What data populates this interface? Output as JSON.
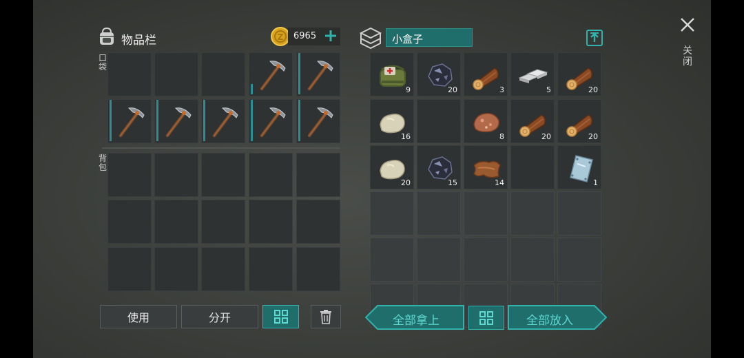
{
  "inventory": {
    "title": "物品栏",
    "currency": "6965",
    "pocket_label": "口袋",
    "backpack_label": "背包",
    "pocket_slots": [
      {
        "item": "",
        "durability": 0
      },
      {
        "item": "",
        "durability": 0
      },
      {
        "item": "",
        "durability": 0
      },
      {
        "item": "pickaxe",
        "durability": 0.25
      },
      {
        "item": "pickaxe",
        "durability": 1.0
      },
      {
        "item": "pickaxe",
        "durability": 1.0
      },
      {
        "item": "pickaxe",
        "durability": 1.0
      },
      {
        "item": "pickaxe",
        "durability": 1.0
      },
      {
        "item": "pickaxe",
        "durability": 1.0
      },
      {
        "item": "pickaxe",
        "durability": 1.0
      }
    ]
  },
  "container": {
    "name": "小盒子",
    "slots": [
      {
        "item": "first-aid-bag",
        "qty": "9"
      },
      {
        "item": "coal-ore",
        "qty": "20"
      },
      {
        "item": "wood-log",
        "qty": "3"
      },
      {
        "item": "iron-ingots",
        "qty": "5"
      },
      {
        "item": "wood-log",
        "qty": "20"
      },
      {
        "item": "stone",
        "qty": "16"
      },
      {
        "item": "",
        "qty": ""
      },
      {
        "item": "copper-ore",
        "qty": "8"
      },
      {
        "item": "wood-log",
        "qty": "20"
      },
      {
        "item": "wood-log",
        "qty": "20"
      },
      {
        "item": "stone",
        "qty": "20"
      },
      {
        "item": "coal-ore",
        "qty": "15"
      },
      {
        "item": "leather",
        "qty": "14"
      },
      {
        "item": "",
        "qty": ""
      },
      {
        "item": "metal-plate",
        "qty": "1"
      }
    ]
  },
  "buttons": {
    "use": "使用",
    "split": "分开",
    "take_all": "全部拿上",
    "put_all": "全部放入",
    "close": "关闭"
  },
  "colors": {
    "accent": "#30b3ad",
    "durability": "#2a8f95",
    "coin": "#d8a21c"
  }
}
